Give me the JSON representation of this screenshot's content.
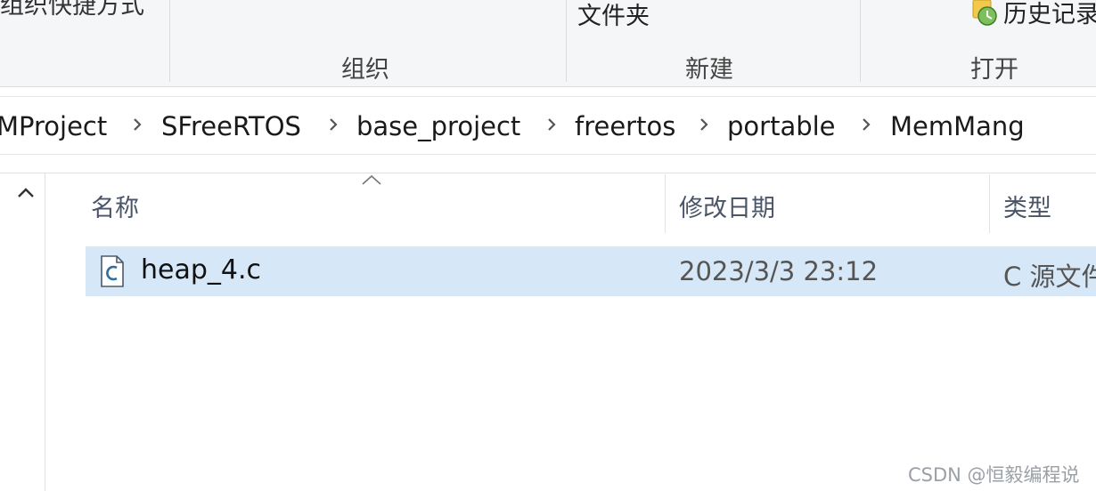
{
  "ribbon": {
    "cut_text": "组织快捷方式",
    "new_folder_label": "文件夹",
    "history_label": "历史记录",
    "groups": [
      "组织",
      "新建",
      "打开"
    ]
  },
  "breadcrumb": [
    "MProject",
    "SFreeRTOS",
    "base_project",
    "freertos",
    "portable",
    "MemMang"
  ],
  "columns": {
    "name": "名称",
    "modified": "修改日期",
    "type": "类型"
  },
  "files": [
    {
      "name": "heap_4.c",
      "modified": "2023/3/3 23:12",
      "type": "C 源文件",
      "icon": "c-file-icon"
    }
  ],
  "watermark": "CSDN @恒毅编程说"
}
